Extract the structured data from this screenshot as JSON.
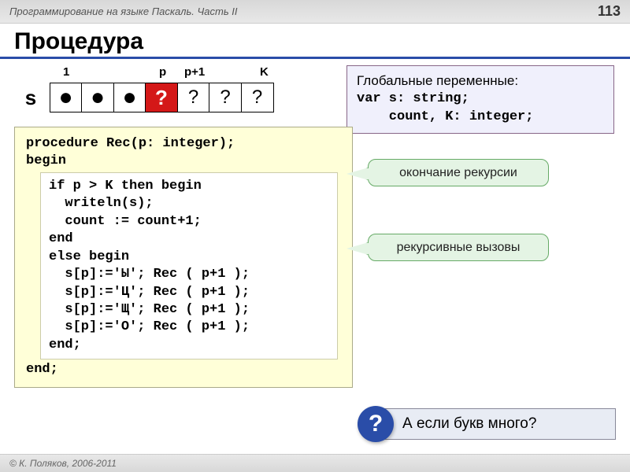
{
  "header": {
    "course": "Программирование на языке Паскаль. Часть II",
    "page": "113"
  },
  "title": "Процедура",
  "array": {
    "s_label": "s",
    "labels": {
      "one": "1",
      "p": "p",
      "p1": "p+1",
      "K": "K"
    },
    "cells": [
      "●",
      "●",
      "●",
      "?",
      "?",
      "?",
      "?"
    ]
  },
  "globals": {
    "heading": "Глобальные переменные:",
    "line1": "var s: string;",
    "line2": "    count, K: integer;"
  },
  "code": {
    "l1": "procedure Rec(p: integer);",
    "l2": "begin",
    "inner": {
      "l1": "if p > K then begin",
      "l2": "  writeln(s);",
      "l3": "  count := count+1;",
      "l4": "end",
      "l5": "else begin",
      "l6": "  s[p]:='Ы'; Rec ( p+1 );",
      "l7": "  s[p]:='Ц'; Rec ( p+1 );",
      "l8": "  s[p]:='Щ'; Rec ( p+1 );",
      "l9": "  s[p]:='О'; Rec ( p+1 );",
      "l10": "end;"
    },
    "l3": "end;"
  },
  "callouts": {
    "c1": "окончание рекурсии",
    "c2": "рекурсивные вызовы"
  },
  "question": {
    "mark": "?",
    "text": "А если букв много?"
  },
  "footer": "© К. Поляков, 2006-2011"
}
